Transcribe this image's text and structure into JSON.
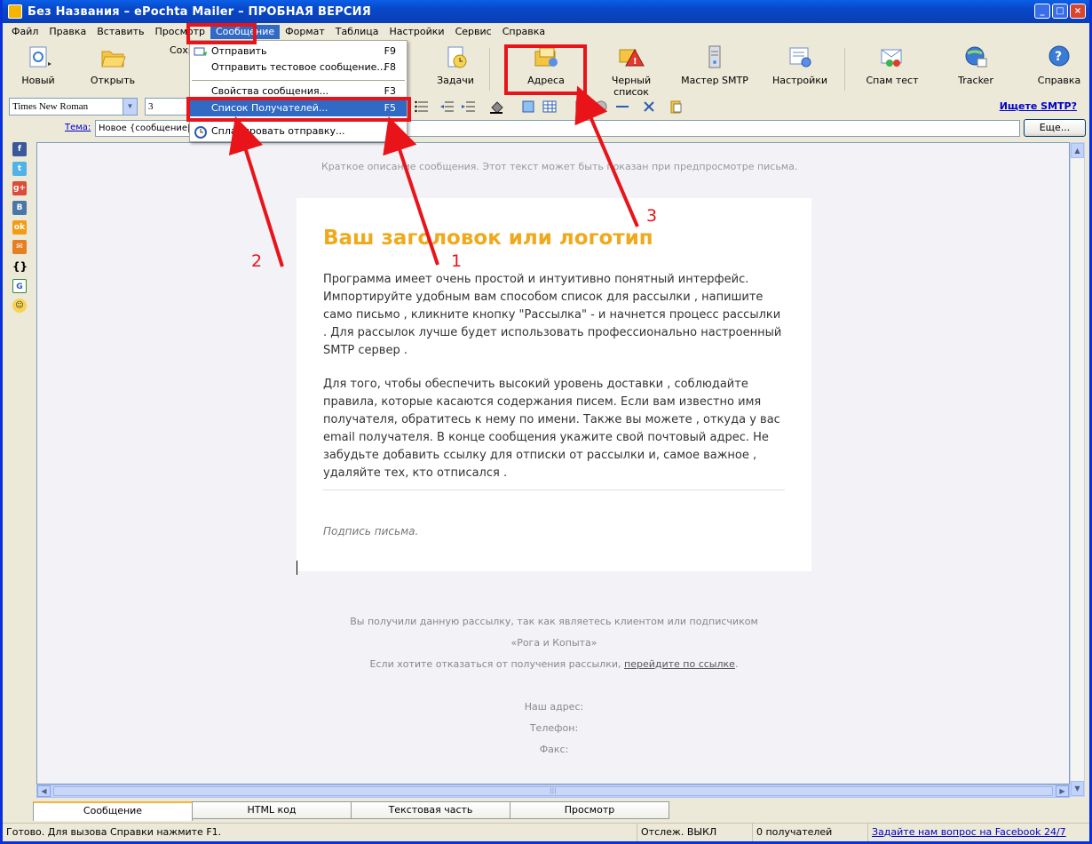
{
  "window": {
    "title": "Без Названия – ePochta Mailer – ПРОБНАЯ ВЕРСИЯ",
    "controls": [
      "_",
      "□",
      "×"
    ]
  },
  "menu": [
    "Файл",
    "Правка",
    "Вставить",
    "Просмотр",
    "Сообщение",
    "Формат",
    "Таблица",
    "Настройки",
    "Сервис",
    "Справка"
  ],
  "toolbar": {
    "new": "Новый",
    "open": "Открыть",
    "save": "Сохр",
    "tasks": "Задачи",
    "addresses": "Адреса",
    "blacklist": "Черный список",
    "smtp_wizard": "Мастер SMTP",
    "settings": "Настройки",
    "spam_test": "Спам тест",
    "tracker": "Tracker",
    "help": "Справка"
  },
  "format": {
    "font": "Times New Roman",
    "size": "3",
    "smtp_link": "Ищете SMTP?"
  },
  "subject": {
    "label": "Тема:",
    "value": "Новое {сообщение|п",
    "more": "Еще..."
  },
  "dropdown": {
    "send": "Отправить",
    "send_sc": "F9",
    "send_test": "Отправить тестовое сообщение...",
    "send_test_sc": "F8",
    "properties": "Свойства сообщения...",
    "properties_sc": "F3",
    "recipients": "Список Получателей...",
    "recipients_sc": "F5",
    "schedule": "Спланировать отправку..."
  },
  "email": {
    "preheader": "Краткое описание сообщения. Этот текст может быть показан при предпросмотре письма.",
    "heading": "Ваш заголовок или логотип",
    "p1": "Программа имеет очень простой и интуитивно понятный интерфейс. Импортируйте удобным вам способом список для рассылки , напишите само письмо , кликните кнопку \"Рассылка\" - и начнется процесс рассылки . Для рассылок лучше будет использовать профессионально настроенный SMTP сервер .",
    "p2": "Для того, чтобы обеспечить высокий уровень доставки , соблюдайте правила, которые касаются содержания писем. Если вам известно имя получателя, обратитесь к нему по имени. Также вы можете , откуда у вас email получателя. В конце сообщения укажите свой почтовый  адрес. Не забудьте добавить ссылку для отписки от рассылки и, самое важное , удаляйте тех, кто отписался .",
    "signature": "Подпись письма.",
    "footer1": "Вы получили данную рассылку, так как являетесь клиентом или подписчиком",
    "footer2": "«Рога и Копыта»",
    "footer3_pre": "Если хотите отказаться от получения рассылки, ",
    "footer3_link": "перейдите по ссылке",
    "footer3_post": ".",
    "address": "Наш адрес:",
    "phone": "Телефон:",
    "fax": "Факс:"
  },
  "tabs": [
    "Сообщение",
    "HTML код",
    "Текстовая часть",
    "Просмотр"
  ],
  "status": {
    "ready": "Готово. Для вызова Справки нажмите F1.",
    "tracking": "Отслеж. ВЫКЛ",
    "recipients": "0 получателей",
    "facebook": "Задайте нам вопрос на Facebook 24/7"
  },
  "annotations": [
    "1",
    "2",
    "3"
  ],
  "colors": {
    "annotation": "#e8141a",
    "heading": "#f0a91b",
    "selection": "#316ac5"
  }
}
